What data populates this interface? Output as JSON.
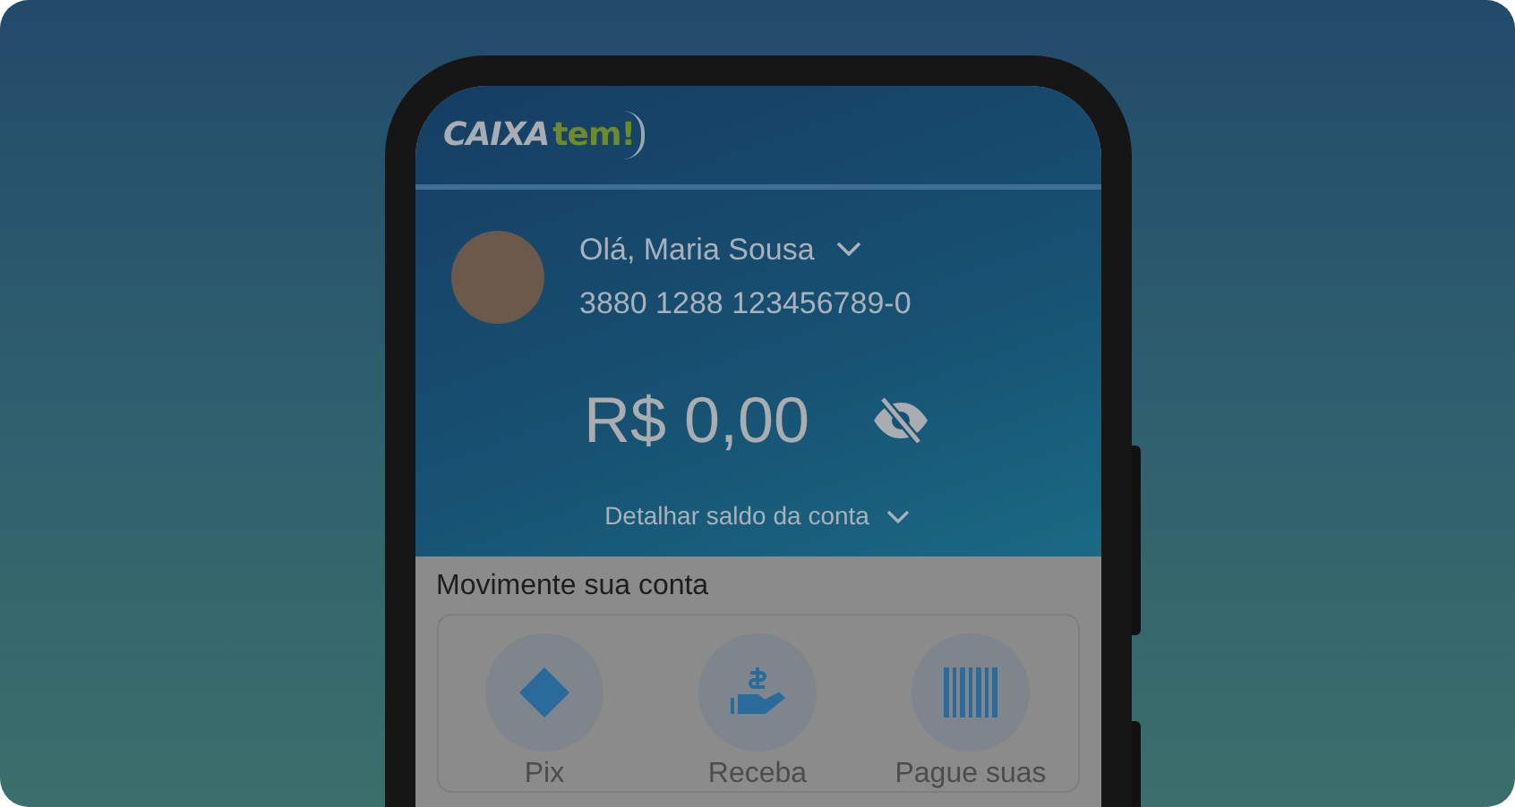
{
  "logo": {
    "word_1": "CAIXA",
    "word_2": "tem!"
  },
  "account": {
    "greeting": "Olá, Maria Sousa",
    "number": "3880 1288 123456789-0"
  },
  "balance": {
    "amount": "R$ 0,00",
    "detail_link": "Detalhar saldo da conta"
  },
  "section": {
    "title": "Movimente sua conta"
  },
  "actions": [
    {
      "kind": "pix",
      "label": "Pix"
    },
    {
      "kind": "receive",
      "label": "Receba"
    },
    {
      "kind": "barcode",
      "label": "Pague suas"
    }
  ]
}
